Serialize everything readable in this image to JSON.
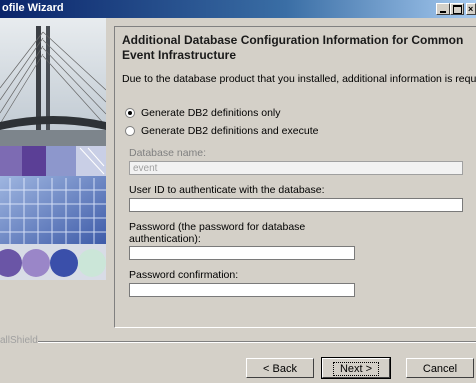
{
  "window": {
    "title": "ofile Wizard"
  },
  "page": {
    "heading": "Additional Database Configuration Information for Common Event Infrastructure",
    "description": "Due to the database product that you installed, additional information is required."
  },
  "options": [
    {
      "label": "Generate DB2 definitions only",
      "selected": true
    },
    {
      "label": "Generate DB2 definitions and execute",
      "selected": false
    }
  ],
  "fields": {
    "database_name": {
      "label": "Database name:",
      "value": "event",
      "enabled": false
    },
    "user_id": {
      "label": "User ID to authenticate with the database:",
      "value": ""
    },
    "password": {
      "label": "Password (the password for database authentication):",
      "value": ""
    },
    "password_confirm": {
      "label": "Password confirmation:",
      "value": ""
    }
  },
  "footer": {
    "brand": "allShield",
    "back": "< Back",
    "next": "Next >",
    "cancel": "Cancel"
  }
}
